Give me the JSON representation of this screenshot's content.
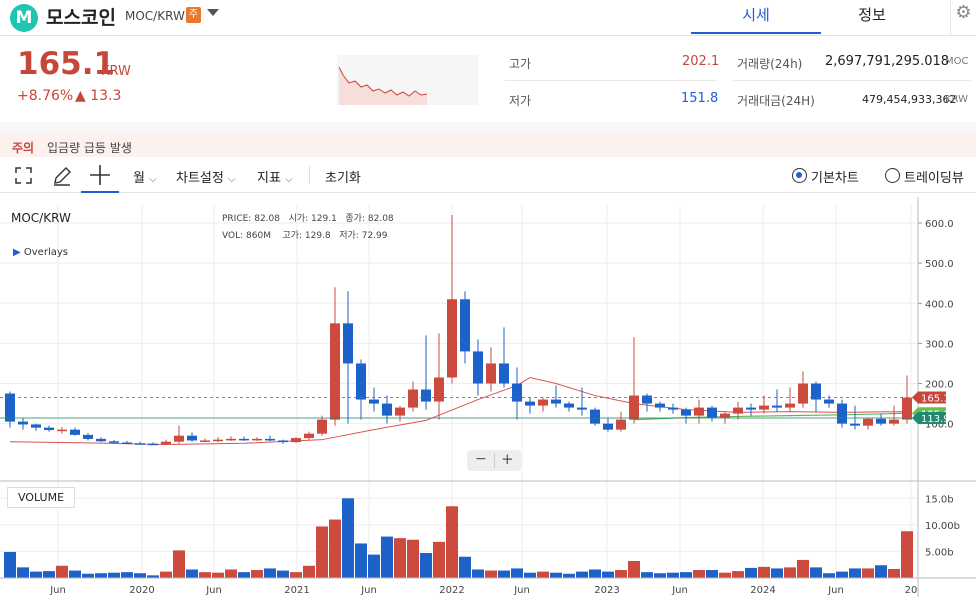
{
  "header": {
    "logo_letter": "M",
    "coin_name": "모스코인",
    "pair": "MOC/KRW",
    "badge": "주",
    "tabs": [
      "시세",
      "정보"
    ],
    "active_tab": "시세"
  },
  "price": {
    "current": "165.1",
    "unit": "KRW",
    "change_pct": "+8.76%",
    "change_abs": "▲ 13.3"
  },
  "stats": {
    "high_label": "고가",
    "high_value": "202.1",
    "low_label": "저가",
    "low_value": "151.8",
    "volume_label": "거래량(24h)",
    "volume_value": "2,697,791,295.018",
    "volume_unit": "MOC",
    "amount_label": "거래대금(24H)",
    "amount_value": "479,454,933,362",
    "amount_unit": "KRW"
  },
  "alert": {
    "tag": "주의",
    "message": "입금량 급등 발생"
  },
  "toolbar": {
    "period": "월",
    "chart_settings": "차트설정",
    "indicators": "지표",
    "reset": "초기화",
    "basic_chart": "기본차트",
    "tradingview": "트레이딩뷰",
    "basic_chart_selected": true
  },
  "chart_info": {
    "symbol": "MOC/KRW",
    "overlays": "Overlays",
    "price_label": "PRICE:",
    "price_val": "82.08",
    "open_label": "시가:",
    "open_val": "129.1",
    "close_label": "종가:",
    "close_val": "82.08",
    "vol_label": "VOL:",
    "vol_val": "860M",
    "high_label": "고가:",
    "high_val": "129.8",
    "low_label": "저가:",
    "low_val": "72.99",
    "volume_title": "VOLUME",
    "zoom_out": "−",
    "zoom_in": "+"
  },
  "chart_data": {
    "type": "candlestick",
    "price_axis": {
      "ticks": [
        100,
        200,
        300,
        400,
        500,
        600
      ],
      "labels": [
        "100.0",
        "200.0",
        "300.0",
        "400.0",
        "500.0",
        "600.0"
      ],
      "range": [
        -33,
        625
      ]
    },
    "volume_axis": {
      "ticks": [
        5,
        10,
        15
      ],
      "labels": [
        "5.00b",
        "10.00b",
        "15.0b"
      ],
      "range": [
        0,
        17.5
      ]
    },
    "x_labels": [
      "Jun",
      "2020",
      "Jun",
      "2021",
      "Jun",
      "2022",
      "Jun",
      "2023",
      "Jun",
      "2024",
      "Jun",
      "20"
    ],
    "price_tags": [
      {
        "label": "165.1",
        "value": 165.1,
        "color": "#c7463a"
      },
      {
        "label": "125.8",
        "value": 125.8,
        "color": "#6abf4b"
      },
      {
        "label": "113.9",
        "value": 113.9,
        "color": "#1e8a6e"
      }
    ],
    "candles": [
      [
        175,
        180,
        90,
        105,
        4.9
      ],
      [
        105,
        115,
        85,
        98,
        2.0
      ],
      [
        98,
        100,
        82,
        90,
        1.2
      ],
      [
        90,
        95,
        80,
        84,
        1.3
      ],
      [
        84,
        92,
        75,
        85,
        2.3
      ],
      [
        85,
        90,
        70,
        72,
        1.4
      ],
      [
        72,
        76,
        58,
        62,
        0.8
      ],
      [
        62,
        66,
        54,
        56,
        0.9
      ],
      [
        56,
        59,
        51,
        53,
        1.0
      ],
      [
        53,
        57,
        49,
        51,
        1.1
      ],
      [
        51,
        55,
        48,
        50,
        0.9
      ],
      [
        50,
        53,
        48,
        49,
        0.5
      ],
      [
        49,
        60,
        47,
        55,
        1.2
      ],
      [
        55,
        95,
        50,
        70,
        5.2
      ],
      [
        70,
        78,
        55,
        58,
        1.6
      ],
      [
        58,
        63,
        55,
        58,
        1.1
      ],
      [
        58,
        66,
        54,
        60,
        1.0
      ],
      [
        60,
        68,
        57,
        62,
        1.6
      ],
      [
        62,
        68,
        57,
        60,
        1.1
      ],
      [
        60,
        66,
        57,
        62,
        1.5
      ],
      [
        62,
        70,
        56,
        58,
        1.8
      ],
      [
        58,
        60,
        50,
        54,
        1.4
      ],
      [
        54,
        66,
        52,
        64,
        1.1
      ],
      [
        64,
        80,
        60,
        75,
        2.3
      ],
      [
        75,
        120,
        70,
        110,
        9.7
      ],
      [
        110,
        440,
        95,
        350,
        11.0
      ],
      [
        350,
        430,
        100,
        250,
        15.0
      ],
      [
        250,
        260,
        110,
        160,
        6.5
      ],
      [
        160,
        190,
        130,
        150,
        4.4
      ],
      [
        150,
        170,
        100,
        120,
        7.8
      ],
      [
        120,
        145,
        105,
        140,
        7.5
      ],
      [
        140,
        205,
        130,
        185,
        7.2
      ],
      [
        185,
        320,
        135,
        155,
        4.7
      ],
      [
        155,
        325,
        110,
        215,
        6.8
      ],
      [
        215,
        620,
        200,
        410,
        13.5
      ],
      [
        410,
        430,
        250,
        280,
        4.0
      ],
      [
        280,
        310,
        170,
        200,
        1.6
      ],
      [
        200,
        290,
        180,
        250,
        1.4
      ],
      [
        250,
        340,
        190,
        200,
        1.4
      ],
      [
        200,
        240,
        110,
        155,
        1.8
      ],
      [
        155,
        165,
        125,
        145,
        1.0
      ],
      [
        145,
        165,
        130,
        160,
        1.2
      ],
      [
        160,
        195,
        140,
        150,
        1.0
      ],
      [
        150,
        155,
        130,
        140,
        0.8
      ],
      [
        140,
        190,
        120,
        135,
        1.2
      ],
      [
        135,
        140,
        95,
        100,
        1.6
      ],
      [
        100,
        115,
        80,
        85,
        1.2
      ],
      [
        85,
        130,
        80,
        110,
        1.5
      ],
      [
        110,
        315,
        100,
        170,
        3.2
      ],
      [
        170,
        175,
        130,
        150,
        1.1
      ],
      [
        150,
        155,
        130,
        140,
        0.9
      ],
      [
        140,
        150,
        125,
        135,
        1.0
      ],
      [
        135,
        140,
        100,
        120,
        1.1
      ],
      [
        120,
        160,
        100,
        140,
        1.5
      ],
      [
        140,
        145,
        105,
        115,
        1.5
      ],
      [
        115,
        130,
        100,
        125,
        1.0
      ],
      [
        125,
        155,
        110,
        140,
        1.3
      ],
      [
        140,
        150,
        120,
        135,
        1.9
      ],
      [
        135,
        170,
        125,
        145,
        2.1
      ],
      [
        145,
        185,
        130,
        140,
        1.8
      ],
      [
        140,
        190,
        130,
        150,
        2.0
      ],
      [
        150,
        230,
        140,
        200,
        3.4
      ],
      [
        200,
        205,
        130,
        160,
        2.0
      ],
      [
        160,
        170,
        140,
        150,
        0.9
      ],
      [
        150,
        160,
        90,
        100,
        1.2
      ],
      [
        100,
        145,
        85,
        95,
        1.8
      ],
      [
        95,
        115,
        85,
        112,
        1.8
      ],
      [
        112,
        125,
        95,
        100,
        2.4
      ],
      [
        100,
        145,
        95,
        110,
        1.7
      ],
      [
        110,
        220,
        100,
        165,
        8.8
      ]
    ],
    "ma_red": [
      [
        0,
        55
      ],
      [
        6,
        52
      ],
      [
        12,
        48
      ],
      [
        18,
        51
      ],
      [
        24,
        60
      ],
      [
        28,
        85
      ],
      [
        32,
        108
      ],
      [
        36,
        160
      ],
      [
        39,
        195
      ],
      [
        40,
        215
      ],
      [
        42,
        200
      ],
      [
        45,
        170
      ],
      [
        48,
        150
      ],
      [
        52,
        135
      ],
      [
        56,
        128
      ],
      [
        60,
        130
      ],
      [
        64,
        128
      ],
      [
        69,
        130
      ]
    ],
    "ma_green": [
      [
        48,
        110
      ],
      [
        52,
        115
      ],
      [
        56,
        118
      ],
      [
        60,
        120
      ],
      [
        64,
        122
      ],
      [
        69,
        125.8
      ]
    ]
  }
}
